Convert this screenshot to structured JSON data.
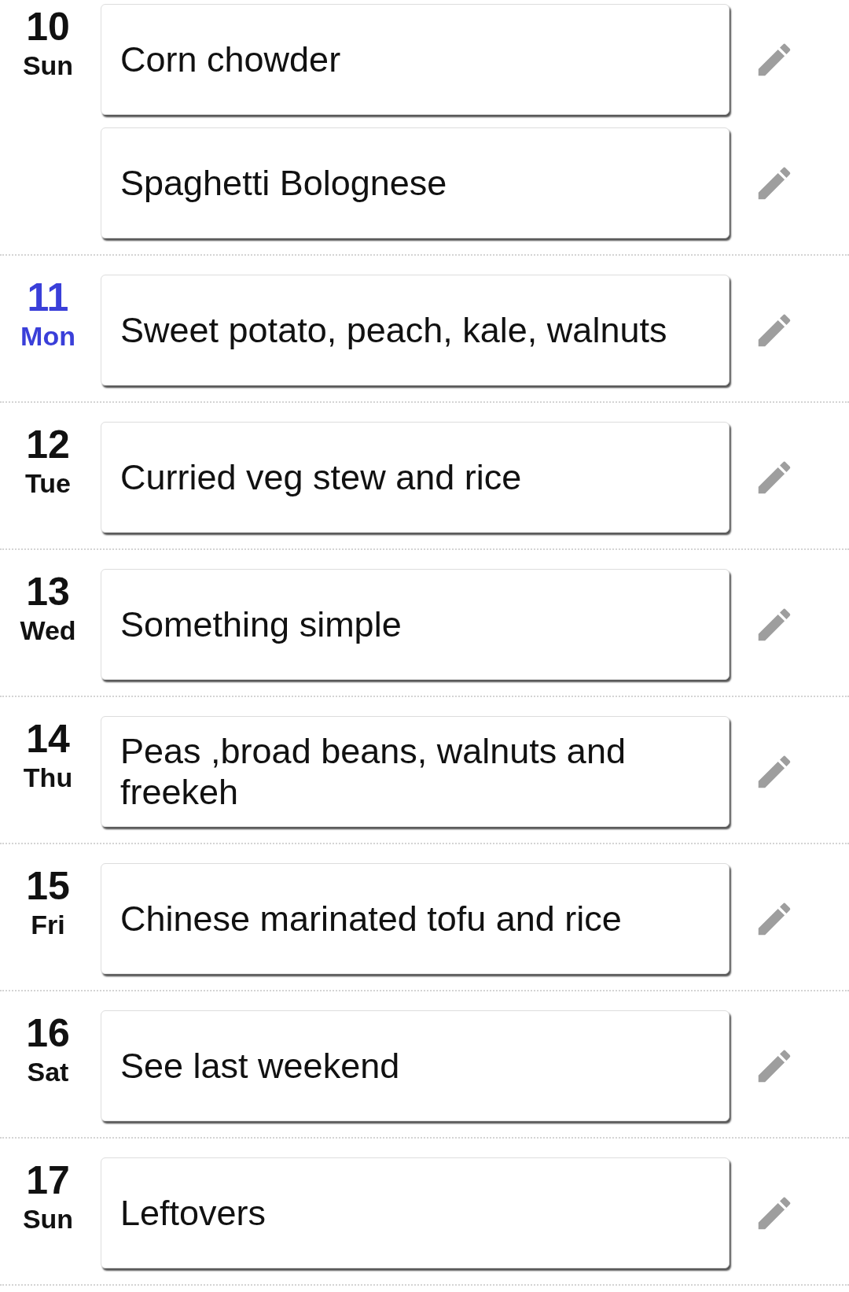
{
  "days": [
    {
      "date": "10",
      "weekday": "Sun",
      "today": false,
      "meals": [
        "Corn chowder",
        "Spaghetti Bolognese"
      ]
    },
    {
      "date": "11",
      "weekday": "Mon",
      "today": true,
      "meals": [
        "Sweet potato, peach, kale, walnuts"
      ]
    },
    {
      "date": "12",
      "weekday": "Tue",
      "today": false,
      "meals": [
        "Curried veg stew and rice"
      ]
    },
    {
      "date": "13",
      "weekday": "Wed",
      "today": false,
      "meals": [
        "Something simple"
      ]
    },
    {
      "date": "14",
      "weekday": "Thu",
      "today": false,
      "meals": [
        "Peas ,broad beans, walnuts and freekeh"
      ]
    },
    {
      "date": "15",
      "weekday": "Fri",
      "today": false,
      "meals": [
        "Chinese marinated tofu and rice"
      ]
    },
    {
      "date": "16",
      "weekday": "Sat",
      "today": false,
      "meals": [
        "See last weekend"
      ]
    },
    {
      "date": "17",
      "weekday": "Sun",
      "today": false,
      "meals": [
        "Leftovers"
      ]
    }
  ]
}
